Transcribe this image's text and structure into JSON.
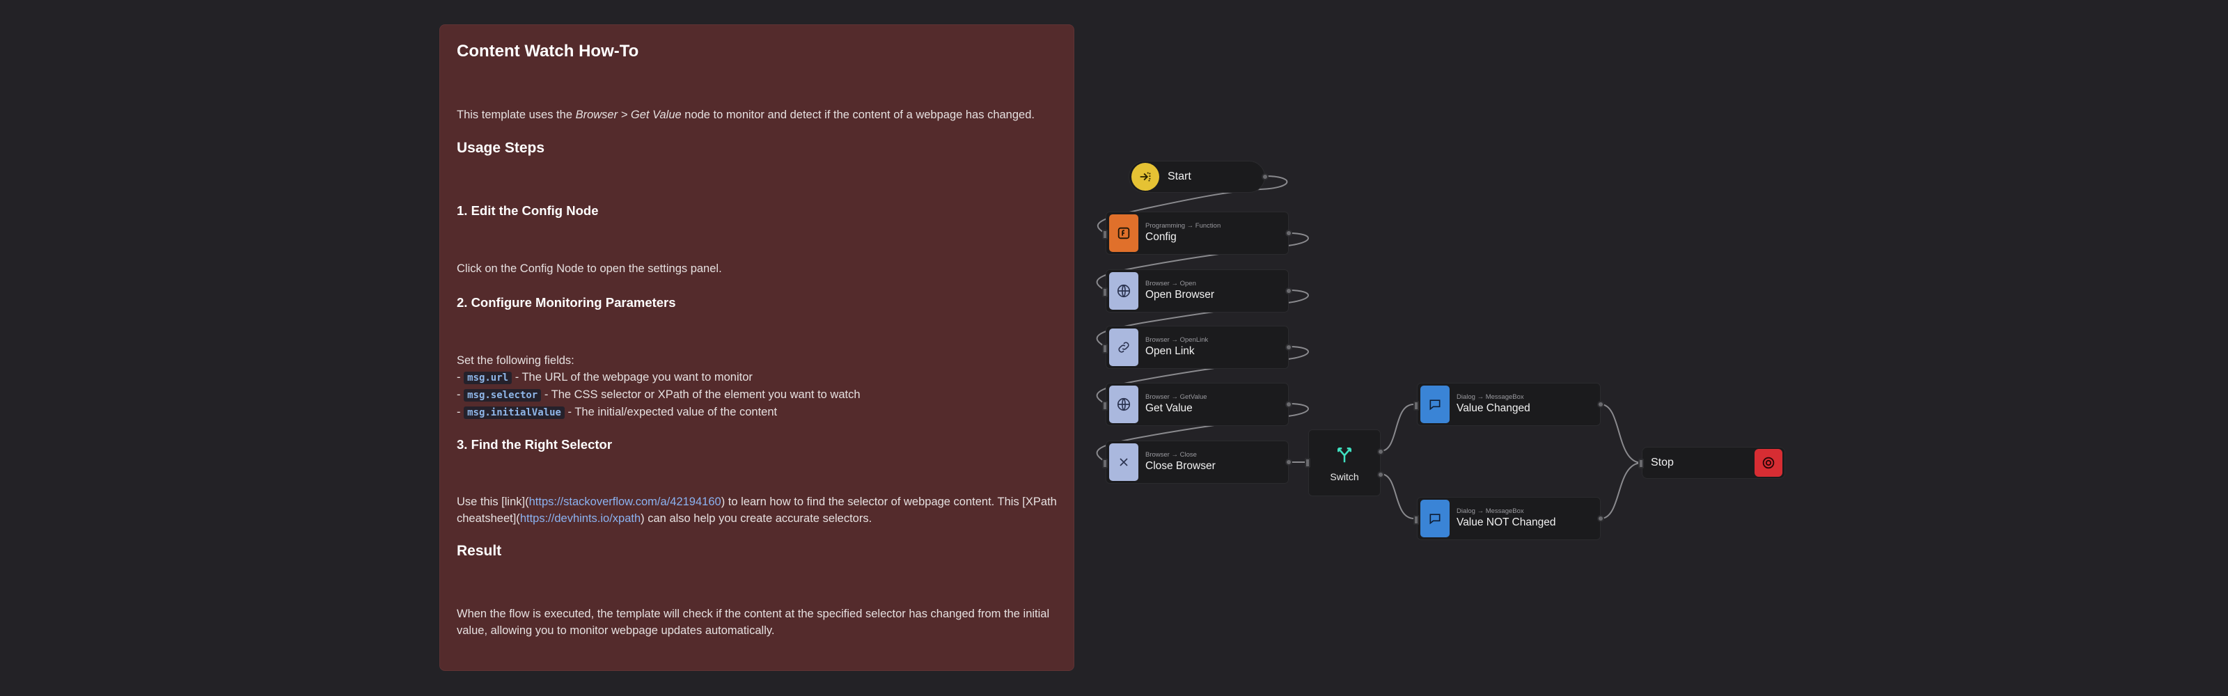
{
  "note": {
    "title": "Content Watch How-To",
    "intro_pre": "This template uses the ",
    "intro_em": "Browser > Get Value",
    "intro_post": " node to monitor and detect if the content of a webpage has changed.",
    "usage_heading": "Usage Steps",
    "step1_heading": "1. Edit the Config Node",
    "step1_text": "Click on the Config Node to open the settings panel.",
    "step2_heading": "2. Configure Monitoring Parameters",
    "step2_text": "Set the following fields:",
    "fields": [
      {
        "dash": "- ",
        "code": "msg.url",
        "desc": " - The URL of the webpage you want to monitor"
      },
      {
        "dash": "- ",
        "code": "msg.selector",
        "desc": " - The CSS selector or XPath of the element you want to watch"
      },
      {
        "dash": "- ",
        "code": "msg.initialValue",
        "desc": " - The initial/expected value of the content"
      }
    ],
    "step3_heading": "3. Find the Right Selector",
    "step3_a": "Use this [link](",
    "step3_link1": "https://stackoverflow.com/a/42194160",
    "step3_b": ") to learn how to find the selector of webpage content. This [XPath cheatsheet](",
    "step3_link2": "https://devhints.io/xpath",
    "step3_c": ") can also help you create accurate selectors.",
    "result_heading": "Result",
    "result_text": "When the flow is executed, the template will check if the content at the specified selector has changed from the initial value, allowing you to monitor webpage updates automatically."
  },
  "nodes": {
    "start": {
      "title": "Start",
      "icon": "start-arrow-icon",
      "color": "#e5c234"
    },
    "config": {
      "category": "Programming → Function",
      "title": "Config",
      "icon": "function-icon",
      "color": "#e0702b"
    },
    "open_browser": {
      "category": "Browser → Open",
      "title": "Open Browser",
      "icon": "globe-icon",
      "color": "#aab8de"
    },
    "open_link": {
      "category": "Browser → OpenLink",
      "title": "Open Link",
      "icon": "link-icon",
      "color": "#aab8de"
    },
    "get_value": {
      "category": "Browser → GetValue",
      "title": "Get Value",
      "icon": "globe-icon",
      "color": "#aab8de"
    },
    "close_browser": {
      "category": "Browser → Close",
      "title": "Close Browser",
      "icon": "close-icon",
      "color": "#aab8de"
    },
    "switch": {
      "title": "Switch",
      "icon": "switch-branch-icon",
      "color": "#3fe0c0"
    },
    "value_changed": {
      "category": "Dialog → MessageBox",
      "title": "Value Changed",
      "icon": "message-icon",
      "color": "#3a84d6"
    },
    "value_not_changed": {
      "category": "Dialog → MessageBox",
      "title": "Value NOT Changed",
      "icon": "message-icon",
      "color": "#3a84d6"
    },
    "stop": {
      "title": "Stop",
      "icon": "stop-target-icon",
      "color": "#d72d33"
    }
  },
  "colors": {
    "canvas_bg": "#232226",
    "note_bg": "#542b2c",
    "wire": "#8a8a8e"
  }
}
